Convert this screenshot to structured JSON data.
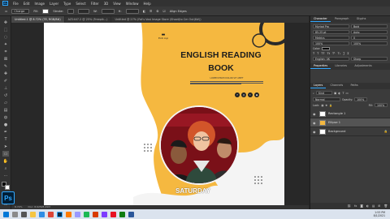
{
  "menu": {
    "app_badge": "Ps",
    "items": [
      "File",
      "Edit",
      "Image",
      "Layer",
      "Type",
      "Select",
      "Filter",
      "3D",
      "View",
      "Window",
      "Help"
    ]
  },
  "options": {
    "chips": [
      "Charge",
      "Fill:",
      "Stroke:",
      "W:",
      "H:"
    ],
    "align_edges": "Align Edges"
  },
  "tabs": [
    {
      "label": "Untitled-1 @ 8.72% (TE, RGB/8#)",
      "active": true
    },
    {
      "label": "AZ2447.2 @ 25% (Freepik...)"
    },
    {
      "label": "Untitled @ 27% (Fat's Vosi Image Store (Shoot)to Cm Out(8#))"
    }
  ],
  "panel": {
    "char_tabs": [
      "Character",
      "Paragraph",
      "Glyphs"
    ],
    "font_name": "Myriad Pro",
    "font_style": "Bold",
    "size_a": "85.25 pt",
    "size_b": "Auto",
    "metrics": "Metrics",
    "tracking": "0",
    "scale_v": "100%",
    "scale_h": "100%",
    "color_label": "Color:",
    "lang": "English: UK",
    "aa": "Sharp",
    "prop_tabs": [
      "Properties",
      "Libraries",
      "Adjustments"
    ],
    "layers_title": "Layers",
    "channels": "Channels",
    "paths": "Paths",
    "kind": "Kind",
    "blend": "Normal",
    "opacity_label": "Opacity:",
    "opacity": "100%",
    "lock_label": "Lock:",
    "fill_label": "Fill:",
    "fill": "100%",
    "layers": [
      {
        "name": "Rectangle 1",
        "selected": false
      },
      {
        "name": "Ellipse 1",
        "selected": true
      },
      {
        "name": "Background",
        "selected": false
      }
    ]
  },
  "artboard": {
    "title_line1": "ENGLISH READING",
    "title_line2": "BOOK",
    "subtitle": "LOREM IPSUM DOLOR SIT AMET",
    "day": "SATURDAY",
    "brand_small": "Photo Logo"
  },
  "status": {
    "zoom": "8.72%",
    "doc": "Doc: 8.62M/8.49M"
  },
  "taskbar": {
    "time": "1:53 PM",
    "date": "8/1/2021"
  },
  "colors": {
    "accent": "#31a8ff",
    "brand_yellow": "#f5b840",
    "dark_red": "#7a1018"
  }
}
